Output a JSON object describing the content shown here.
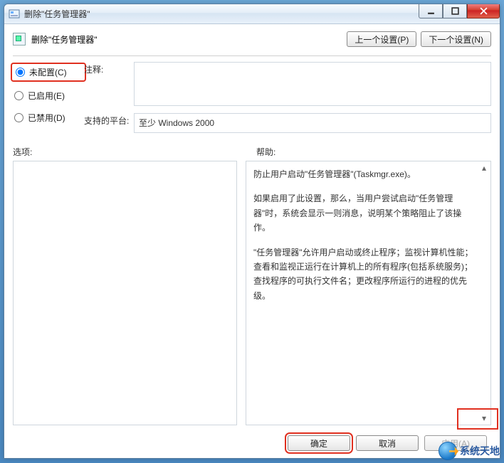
{
  "window": {
    "title": "删除\"任务管理器\""
  },
  "header": {
    "policy_label": "删除\"任务管理器\"",
    "prev_setting": "上一个设置(P)",
    "next_setting": "下一个设置(N)"
  },
  "radios": {
    "not_configured": "未配置(C)",
    "enabled": "已启用(E)",
    "disabled": "已禁用(D)"
  },
  "meta": {
    "comment_label": "注释:",
    "comment_value": "",
    "platform_label": "支持的平台:",
    "platform_value": "至少 Windows 2000"
  },
  "panes": {
    "options_label": "选项:",
    "help_label": "帮助:"
  },
  "help": {
    "p1": "防止用户启动\"任务管理器\"(Taskmgr.exe)。",
    "p2": "如果启用了此设置，那么，当用户尝试启动\"任务管理器\"时，系统会显示一则消息，说明某个策略阻止了该操作。",
    "p3": "\"任务管理器\"允许用户启动或终止程序；监视计算机性能；查看和监视正运行在计算机上的所有程序(包括系统服务)；查找程序的可执行文件名；更改程序所运行的进程的优先级。"
  },
  "footer": {
    "ok": "确定",
    "cancel": "取消",
    "apply": "应用(A)"
  },
  "watermark": {
    "text": "系统天地"
  }
}
